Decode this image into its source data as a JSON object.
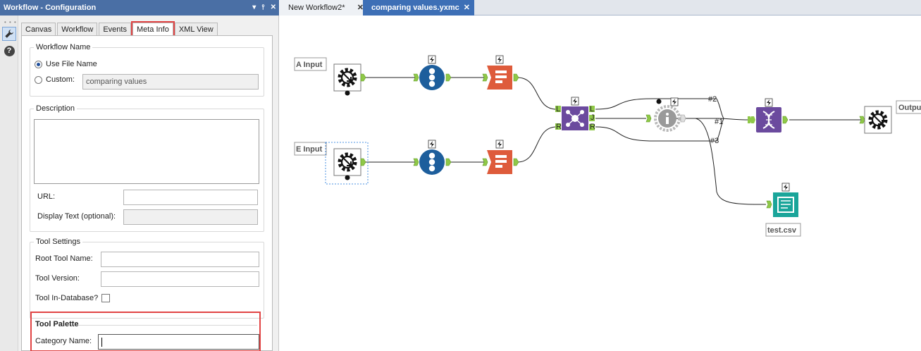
{
  "panel": {
    "title": "Workflow - Configuration",
    "title_controls": [
      "▾",
      "📌",
      "✕"
    ]
  },
  "tabs": [
    "Canvas",
    "Workflow",
    "Events",
    "Meta Info",
    "XML View"
  ],
  "active_tab": "Meta Info",
  "workflow_name": {
    "legend": "Workflow Name",
    "use_file_name_label": "Use File Name",
    "custom_label": "Custom:",
    "custom_value": "comparing values"
  },
  "description": {
    "legend": "Description",
    "url_label": "URL:",
    "display_text_label": "Display Text (optional):"
  },
  "tool_settings": {
    "legend": "Tool Settings",
    "root_tool_name_label": "Root Tool Name:",
    "tool_version_label": "Tool Version:",
    "tool_in_database_label": "Tool In-Database?"
  },
  "tool_palette": {
    "legend": "Tool Palette",
    "category_name_label": "Category Name:",
    "category_name_value": ""
  },
  "document_tabs": [
    {
      "label": "New Workflow2*",
      "active": false
    },
    {
      "label": "comparing values.yxmc",
      "active": true
    }
  ],
  "canvas": {
    "input_a_label": "A Input",
    "input_e_label": "E Input",
    "output_label": "Output",
    "file_label": "test.csv",
    "join_anchors": [
      "L",
      "J",
      "R"
    ],
    "connection_labels": [
      "#2",
      "#1",
      "#3"
    ]
  },
  "colors": {
    "title_bar": "#4a6fa5",
    "highlight": "#e14444",
    "record_id": "#1d5e9c",
    "select": "#de5b3b",
    "join": "#6b4a9e",
    "output_file": "#1aa59a",
    "anchor": "#8fc848"
  }
}
